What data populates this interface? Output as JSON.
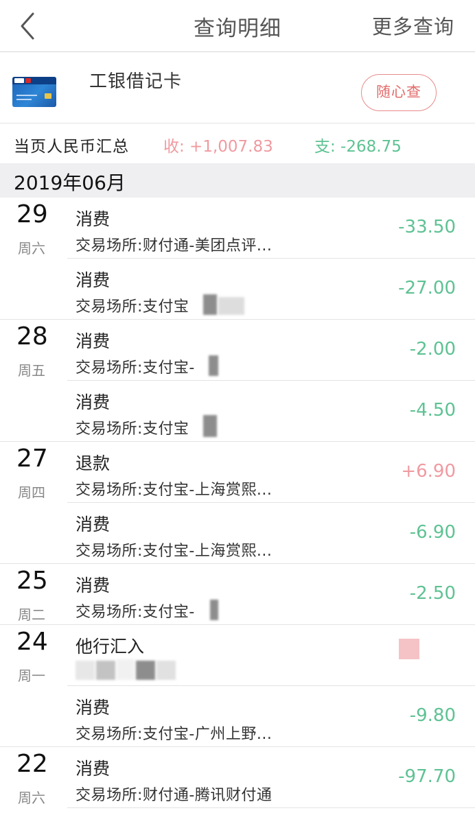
{
  "header": {
    "title": "查询明细",
    "more_label": "更多查询"
  },
  "card": {
    "name": "工银借记卡",
    "random_query_label": "随心查"
  },
  "summary": {
    "label": "当页人民币汇总",
    "income": "收: +1,007.83",
    "expense": "支: -268.75"
  },
  "month": "2019年06月",
  "transactions": [
    {
      "date": "29",
      "weekday": "周六",
      "type": "消费",
      "merchant": "交易场所:财付通-美团点评...",
      "amount": "-33.50"
    },
    {
      "date": "",
      "weekday": "",
      "type": "消费",
      "merchant": "交易场所:支付宝",
      "amount": "-27.00"
    },
    {
      "date": "28",
      "weekday": "周五",
      "type": "消费",
      "merchant": "交易场所:支付宝-",
      "amount": "-2.00"
    },
    {
      "date": "",
      "weekday": "",
      "type": "消费",
      "merchant": "交易场所:支付宝",
      "amount": "-4.50"
    },
    {
      "date": "27",
      "weekday": "周四",
      "type": "退款",
      "merchant": "交易场所:支付宝-上海赏熙...",
      "amount": "+6.90"
    },
    {
      "date": "",
      "weekday": "",
      "type": "消费",
      "merchant": "交易场所:支付宝-上海赏熙...",
      "amount": "-6.90"
    },
    {
      "date": "25",
      "weekday": "周二",
      "type": "消费",
      "merchant": "交易场所:支付宝-",
      "amount": "-2.50"
    },
    {
      "date": "24",
      "weekday": "周一",
      "type": "他行汇入",
      "merchant": "",
      "amount": ""
    },
    {
      "date": "",
      "weekday": "",
      "type": "消费",
      "merchant": "交易场所:支付宝-广州上野...",
      "amount": "-9.80"
    },
    {
      "date": "22",
      "weekday": "周六",
      "type": "消费",
      "merchant": "交易场所:财付通-腾讯财付通",
      "amount": "-97.70"
    }
  ],
  "colors": {
    "income": "#f09aa0",
    "expense": "#5ec293",
    "accent_button": "#e26b6b"
  },
  "icons": {
    "back": "chevron-left-icon",
    "card": "bank-card-icon"
  }
}
